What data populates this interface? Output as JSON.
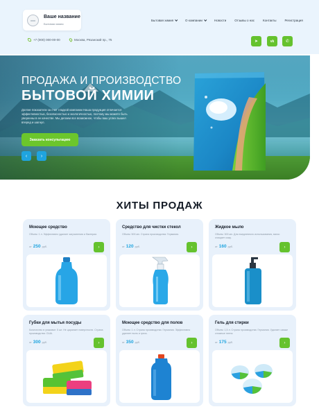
{
  "header": {
    "logo_title": "Ваше название",
    "logo_subtitle": "Бытовая химия",
    "nav": [
      {
        "label": "Бытовая химия",
        "dropdown": true
      },
      {
        "label": "О компании",
        "dropdown": true
      },
      {
        "label": "Новости",
        "dropdown": false
      },
      {
        "label": "Отзывы о нас",
        "dropdown": false
      },
      {
        "label": "Контакты",
        "dropdown": false
      },
      {
        "label": "Регистрация",
        "dropdown": false
      }
    ],
    "phone": "+7 (000) 000-00-00",
    "address": "Москва, Рязанский пр., 75",
    "social": [
      {
        "name": "telegram-icon",
        "glyph": "➤"
      },
      {
        "name": "vk-icon",
        "glyph": "vk"
      },
      {
        "name": "viber-icon",
        "glyph": "✆"
      }
    ]
  },
  "hero": {
    "title_line1": "ПРОДАЖА И ПРОИЗВОДСТВО",
    "title_line2": "БЫТОВОЙ ХИМИИ",
    "description": "Долгие показатели за счет гладкой компании Наша продукция отличается эффективностью, безопасностью и экологичностью, поэтому мы можете быть уверенны в ее качестве. Мы делаем все возможное, чтобы ваш успех вышел вперед и шагнул.",
    "cta_label": "Заказать консультацию",
    "prev_glyph": "‹",
    "next_glyph": "›"
  },
  "section": {
    "title": "ХИТЫ ПРОДАЖ"
  },
  "products": [
    {
      "name": "Моющее средство",
      "desc": "Объем: 1 л. Эффективно удаляет загрязнения и бактерии.",
      "price_prefix": "от",
      "price": "250",
      "currency": "руб.",
      "image": "blue-bottle"
    },
    {
      "name": "Средство для чистки стекол",
      "desc": "Объем: 500 мл. Страна производства: Германия.",
      "price_prefix": "от",
      "price": "120",
      "currency": "руб.",
      "image": "spray-bottle"
    },
    {
      "name": "Жидкое мыло",
      "desc": "Объем: 300 мл. Для ежедневного использования, мягко очищает кожу.",
      "price_prefix": "от",
      "price": "160",
      "currency": "руб.",
      "image": "soap-dispenser"
    },
    {
      "name": "Губки для мытья посуды",
      "desc": "Количество в упаковке: 5 шт. Не царапает поверхности. Страна производства: США.",
      "price_prefix": "от",
      "price": "300",
      "currency": "руб.",
      "image": "sponges"
    },
    {
      "name": "Моющее средство для полов",
      "desc": "Объем: 1 л. Страна производства: Германия. Эффективно удаляет пыль и грязь.",
      "price_prefix": "от",
      "price": "350",
      "currency": "руб.",
      "image": "floor-cleaner"
    },
    {
      "name": "Гель для стирки",
      "desc": "Объем: 1,5 л. Страна производства: Германия. Удаляет самые сложные пятна.",
      "price_prefix": "от",
      "price": "175",
      "currency": "руб.",
      "image": "laundry-pods"
    }
  ],
  "colors": {
    "accent_green": "#65c22e",
    "accent_blue": "#1fa4df",
    "header_bg": "#eaf4fd",
    "card_bg": "#e8f1fb"
  }
}
